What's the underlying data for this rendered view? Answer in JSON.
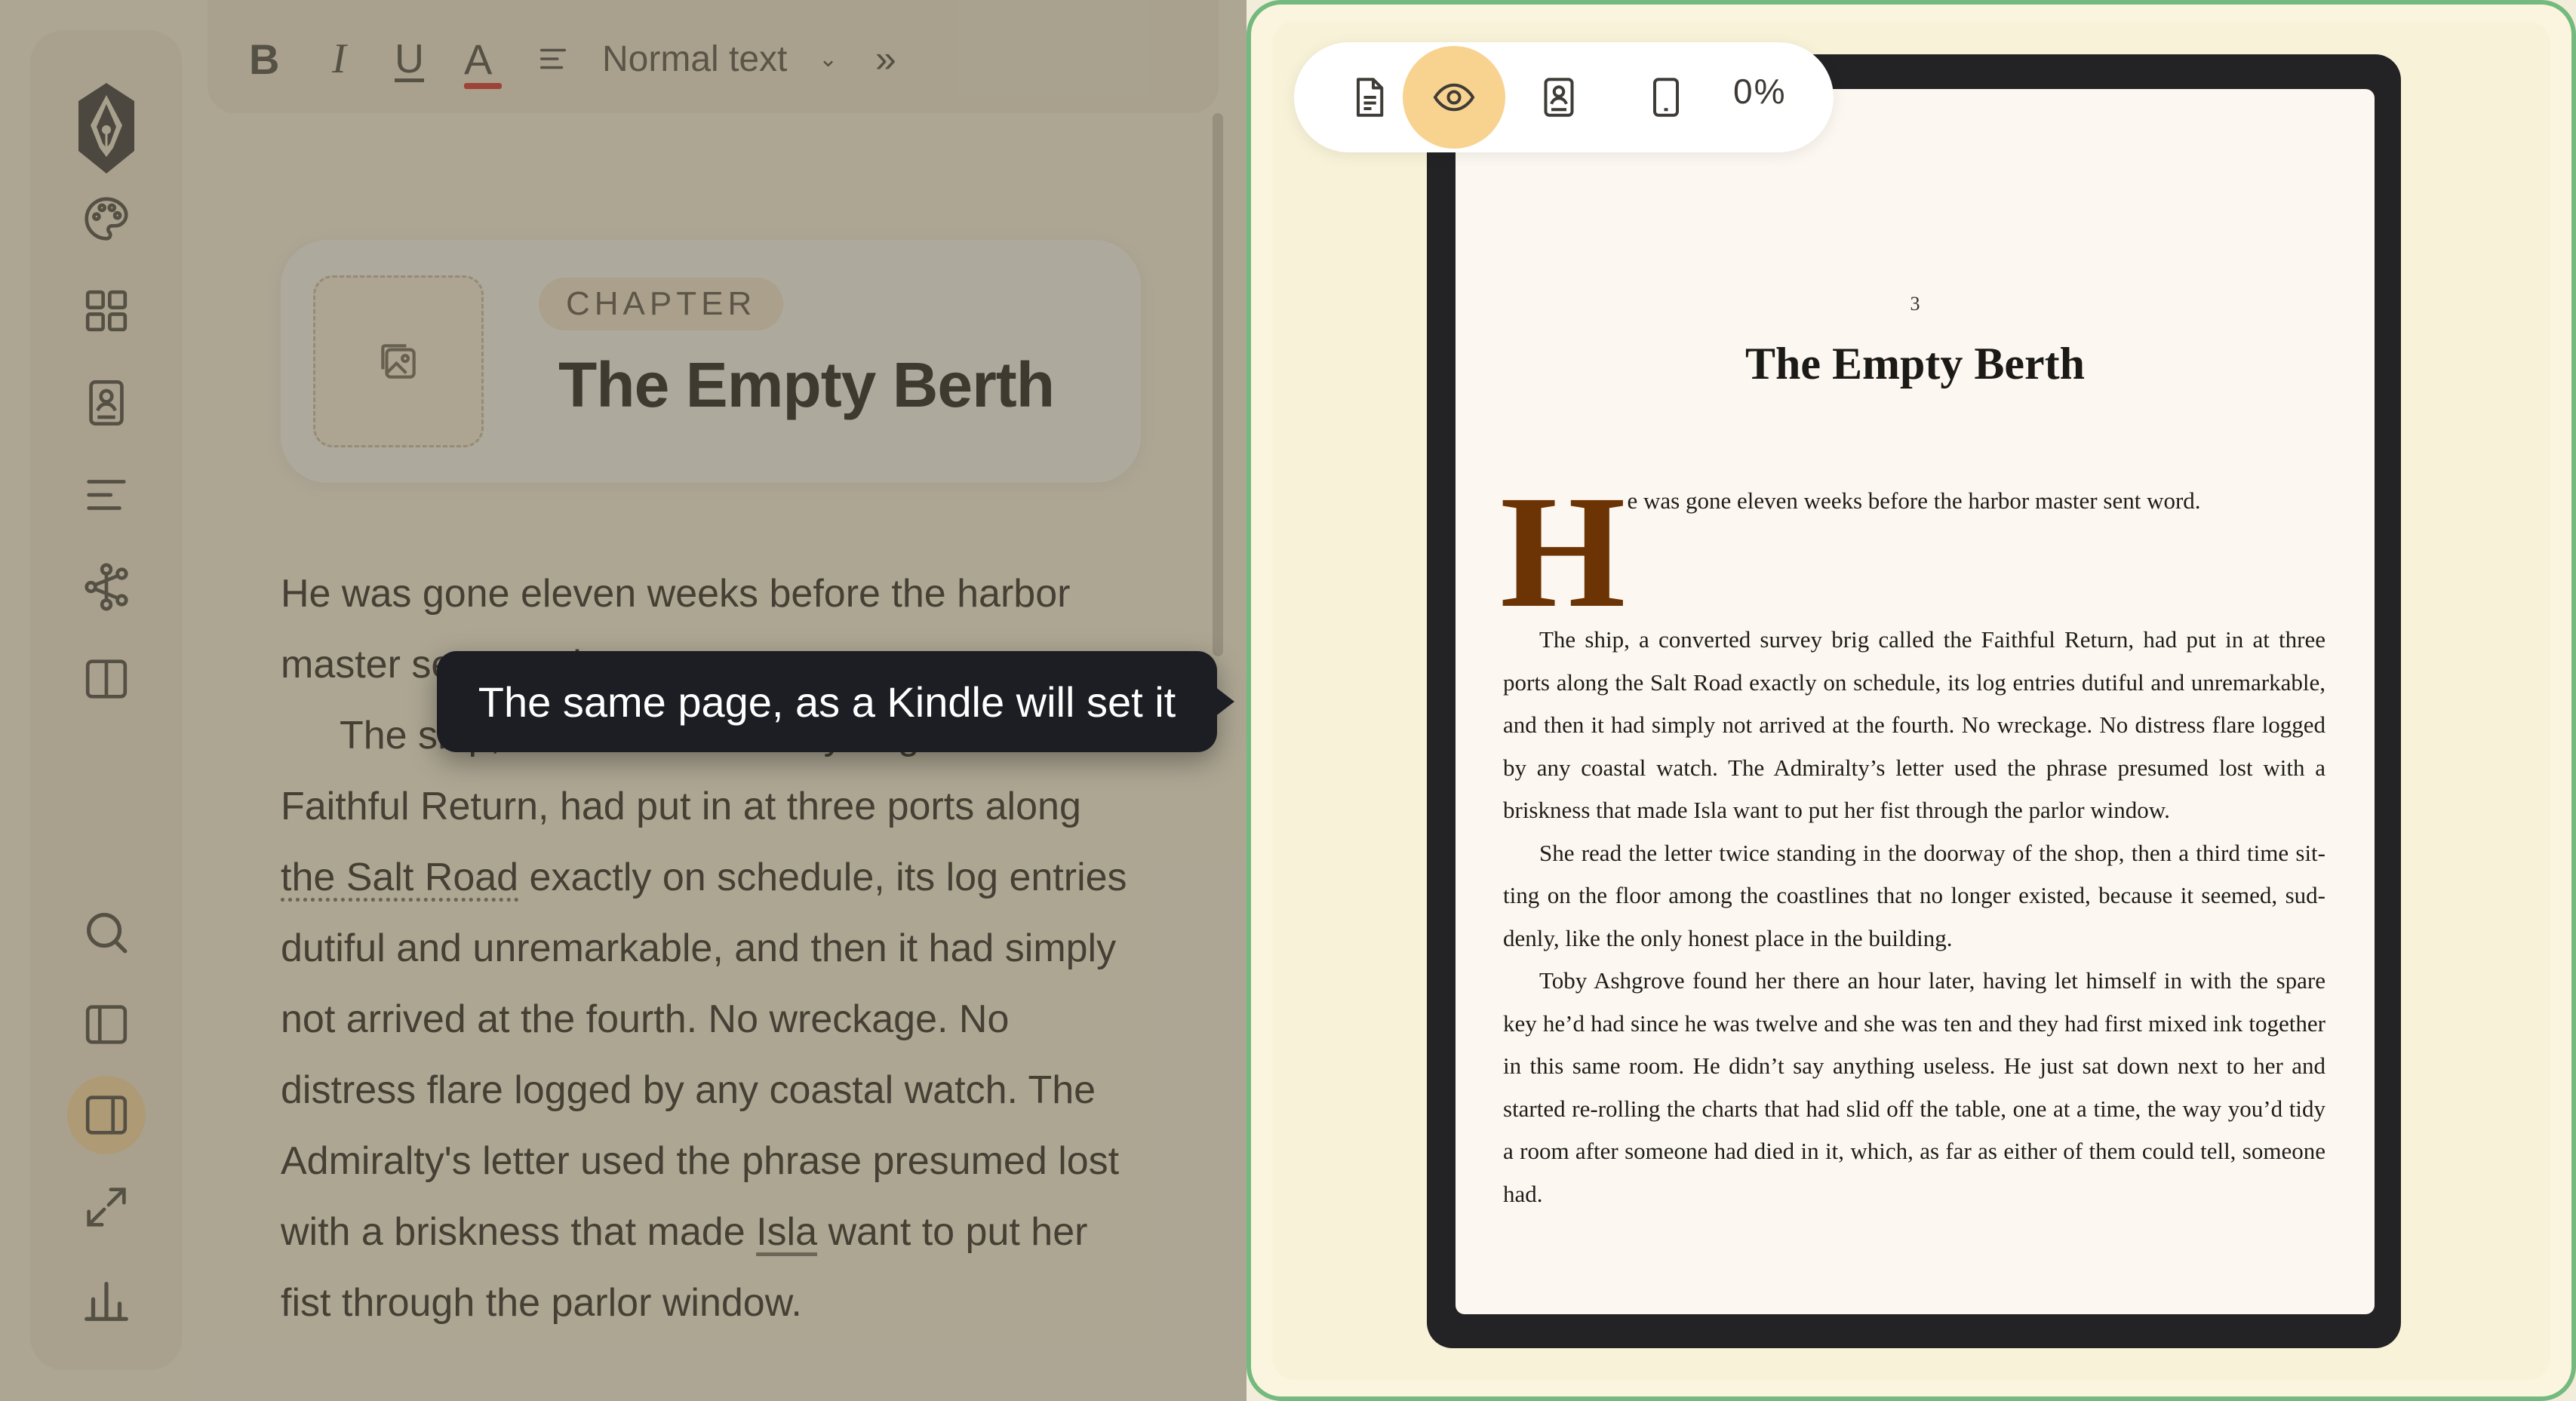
{
  "toolbar": {
    "bold": "B",
    "italic": "I",
    "underline": "U",
    "text_color": "A",
    "text_color_swatch": "#d5302b",
    "paragraph_style": "Normal text",
    "more": "»"
  },
  "sidebar": {
    "items": [
      {
        "icon": "palette-icon"
      },
      {
        "icon": "grid-icon"
      },
      {
        "icon": "contact-book-icon"
      },
      {
        "icon": "align-left-icon"
      },
      {
        "icon": "flow-icon"
      },
      {
        "icon": "split-view-icon"
      },
      {
        "icon": "search-icon"
      },
      {
        "icon": "sidebar-panel-icon"
      },
      {
        "icon": "preview-panel-icon",
        "active": true
      },
      {
        "icon": "expand-icon"
      },
      {
        "icon": "bar-chart-icon"
      }
    ]
  },
  "chapter": {
    "badge": "CHAPTER",
    "title": "The Empty Berth"
  },
  "editor": {
    "p1": "He was gone eleven weeks before the harbor master sent word.",
    "p2_a": "The ship, a converted survey brig called the Faithful Return, had put in at three ports along ",
    "p2_link1": "the Salt Road",
    "p2_b": " exactly on schedule, its log entries dutiful and unremarkable, and then it had simply not arrived at the fourth. No wreckage. No distress flare logged by any coastal watch. The Admiralty's letter used the phrase presumed lost with a briskness that made ",
    "p2_link2": "Isla",
    "p2_c": " want to put her fist through the parlor window."
  },
  "tooltip": "The same page, as a Kindle will set it",
  "preview": {
    "zoom": "0%",
    "page_number": "3",
    "title": "The Empty Berth",
    "dropcap": "H",
    "para1": "e was gone eleven weeks before the harbor master sent word.",
    "para2": "The ship, a converted survey brig called the Faithful Return, had put in at three ports along the Salt Road exactly on schedule, its log entries dutiful and unremarkable, and then it had simply not arrived at the fourth. No wreckage. No distress flare logged by any coastal watch. The Admiralty’s letter used the phrase presumed lost with a brisk­ness that made Isla want to put her fist through the parlor window.",
    "para3": "She read the letter twice standing in the doorway of the shop, then a third time sit­ting on the floor among the coastlines that no longer existed, because it seemed, sud­denly, like the only honest place in the building.",
    "para4": "Toby Ashgrove found her there an hour later, having let himself in with the spare key he’d had since he was twelve and she was ten and they had first mixed ink together in this same room. He didn’t say anything useless. He just sat down next to her and started re-rolling the charts that had slid off the table, one at a time, the way you’d tidy a room after someone had died in it, which, as far as either of them could tell, someone had."
  },
  "colors": {
    "accent": "#f8d28f",
    "preview_border": "#74b97d",
    "dropcap": "#6c3305"
  }
}
